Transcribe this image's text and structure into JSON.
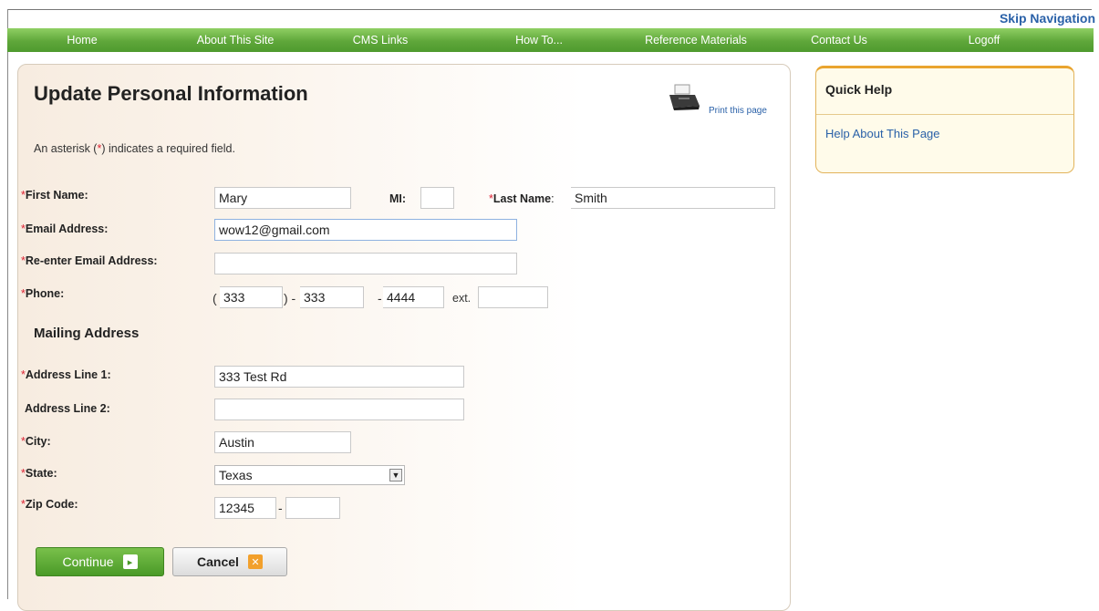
{
  "skip_nav": "Skip Navigation",
  "nav": [
    "Home",
    "About This Site",
    "CMS Links",
    "How To...",
    "Reference Materials",
    "Contact Us",
    "Logoff"
  ],
  "page_title": "Update Personal Information",
  "print_link": "Print this page",
  "required_note": {
    "prefix": "An asterisk (",
    "asterisk": "*",
    "suffix": ") indicates a required field."
  },
  "fields": {
    "first_name": {
      "label": "First Name:",
      "value": "Mary"
    },
    "mi": {
      "label": "MI:",
      "value": ""
    },
    "last_name": {
      "label": "Last Name",
      "colon": ":",
      "value": "Smith"
    },
    "email": {
      "label": "Email Address:",
      "value": "wow12@gmail.com"
    },
    "reenter_email": {
      "label": "Re-enter Email Address:",
      "value": ""
    },
    "phone": {
      "label": "Phone:",
      "area": "333",
      "prefix": "333",
      "line": "4444",
      "ext_label": "ext.",
      "ext": "",
      "open_paren": "(",
      "close_paren": ") -",
      "dash": "-"
    }
  },
  "mailing_address_title": "Mailing Address",
  "address": {
    "line1": {
      "label": "Address Line 1:",
      "value": "333 Test Rd"
    },
    "line2": {
      "label": "Address Line 2:",
      "value": ""
    },
    "city": {
      "label": "City:",
      "value": "Austin"
    },
    "state": {
      "label": "State:",
      "value": "Texas"
    },
    "zip": {
      "label": "Zip Code:",
      "value": "12345",
      "plus4": "",
      "dash": "-"
    }
  },
  "asterisk": "*",
  "buttons": {
    "continue": "Continue",
    "cancel": "Cancel",
    "continue_icon": "▸",
    "cancel_icon": "✕"
  },
  "quick_help": {
    "title": "Quick Help",
    "link": "Help About This Page"
  },
  "colors": {
    "nav_green": "#5fa73a",
    "link_blue": "#2a61a8",
    "required_red": "#d23",
    "help_border": "#e9a42f"
  }
}
